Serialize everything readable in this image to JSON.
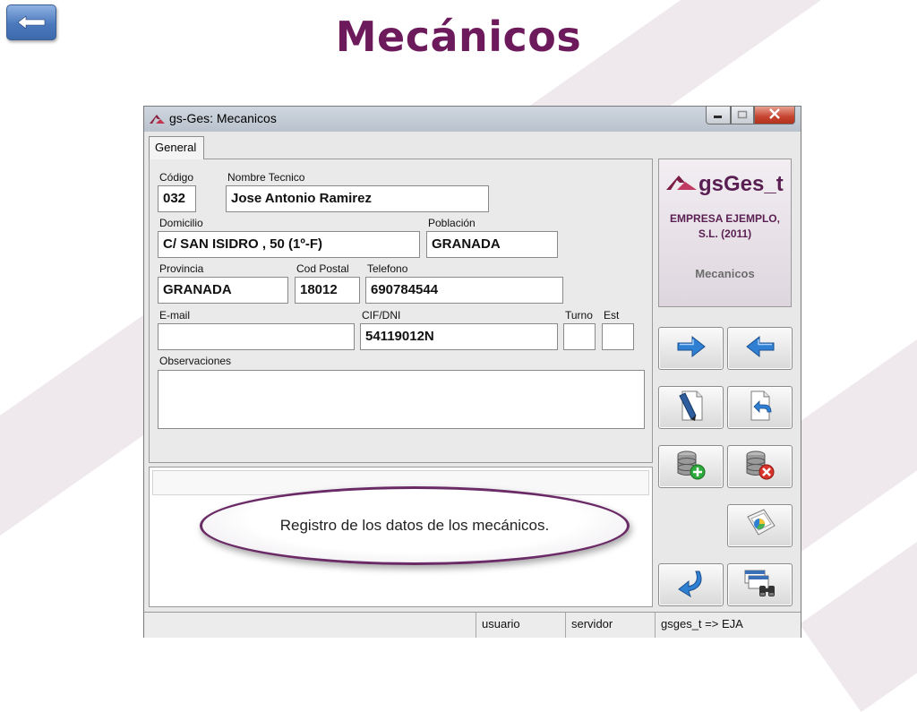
{
  "slide": {
    "title": "Mecánicos"
  },
  "window": {
    "title": "gs-Ges: Mecanicos",
    "tab": "General"
  },
  "form": {
    "codigo": {
      "label": "Código",
      "value": "032"
    },
    "nombre": {
      "label": "Nombre Tecnico",
      "value": "Jose Antonio Ramirez"
    },
    "domicilio": {
      "label": "Domicilio",
      "value": "C/ SAN ISIDRO , 50 (1º-F)"
    },
    "poblacion": {
      "label": "Población",
      "value": "GRANADA"
    },
    "provincia": {
      "label": "Provincia",
      "value": "GRANADA"
    },
    "cod_postal": {
      "label": "Cod Postal",
      "value": "18012"
    },
    "telefono": {
      "label": "Telefono",
      "value": "690784544"
    },
    "email": {
      "label": "E-mail",
      "value": ""
    },
    "cif": {
      "label": "CIF/DNI",
      "value": "54119012N"
    },
    "turno": {
      "label": "Turno",
      "value": ""
    },
    "est": {
      "label": "Est",
      "value": ""
    },
    "observaciones": {
      "label": "Observaciones",
      "value": ""
    }
  },
  "callout": {
    "text": "Registro  de los datos de los mecánicos."
  },
  "logo": {
    "name": "gsGes_t",
    "company": "EMPRESA EJEMPLO, S.L. (2011)",
    "module": "Mecanicos"
  },
  "toolbar_icons": [
    "arrow-right-icon",
    "arrow-left-icon",
    "edit-document-icon",
    "undo-document-icon",
    "database-add-icon",
    "database-delete-icon",
    "print-preview-icon",
    "return-icon",
    "search-binoculars-icon"
  ],
  "statusbar": {
    "cell1": "",
    "usuario": "usuario",
    "servidor": "servidor",
    "empresa": "gsges_t => EJA"
  },
  "colors": {
    "brand": "#6c1a5c",
    "callout_border": "#6a2a66",
    "arrow_blue": "#2f7fd2"
  }
}
